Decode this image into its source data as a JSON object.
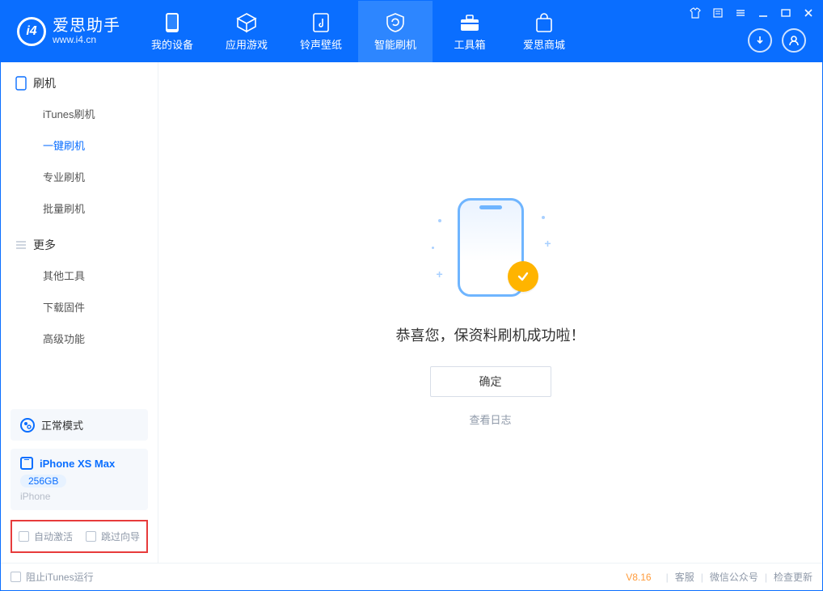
{
  "app": {
    "title": "爱思助手",
    "subtitle": "www.i4.cn"
  },
  "nav": {
    "tabs": [
      {
        "label": "我的设备"
      },
      {
        "label": "应用游戏"
      },
      {
        "label": "铃声壁纸"
      },
      {
        "label": "智能刷机"
      },
      {
        "label": "工具箱"
      },
      {
        "label": "爱思商城"
      }
    ]
  },
  "sidebar": {
    "group1": {
      "title": "刷机",
      "items": [
        "iTunes刷机",
        "一键刷机",
        "专业刷机",
        "批量刷机"
      ]
    },
    "group2": {
      "title": "更多",
      "items": [
        "其他工具",
        "下载固件",
        "高级功能"
      ]
    },
    "mode_label": "正常模式",
    "device": {
      "name": "iPhone XS Max",
      "capacity": "256GB",
      "type": "iPhone"
    },
    "cb_auto_activate": "自动激活",
    "cb_skip_guide": "跳过向导"
  },
  "main": {
    "success_text": "恭喜您，保资料刷机成功啦！",
    "ok_button": "确定",
    "view_log": "查看日志"
  },
  "footer": {
    "block_itunes": "阻止iTunes运行",
    "version": "V8.16",
    "links": [
      "客服",
      "微信公众号",
      "检查更新"
    ]
  }
}
